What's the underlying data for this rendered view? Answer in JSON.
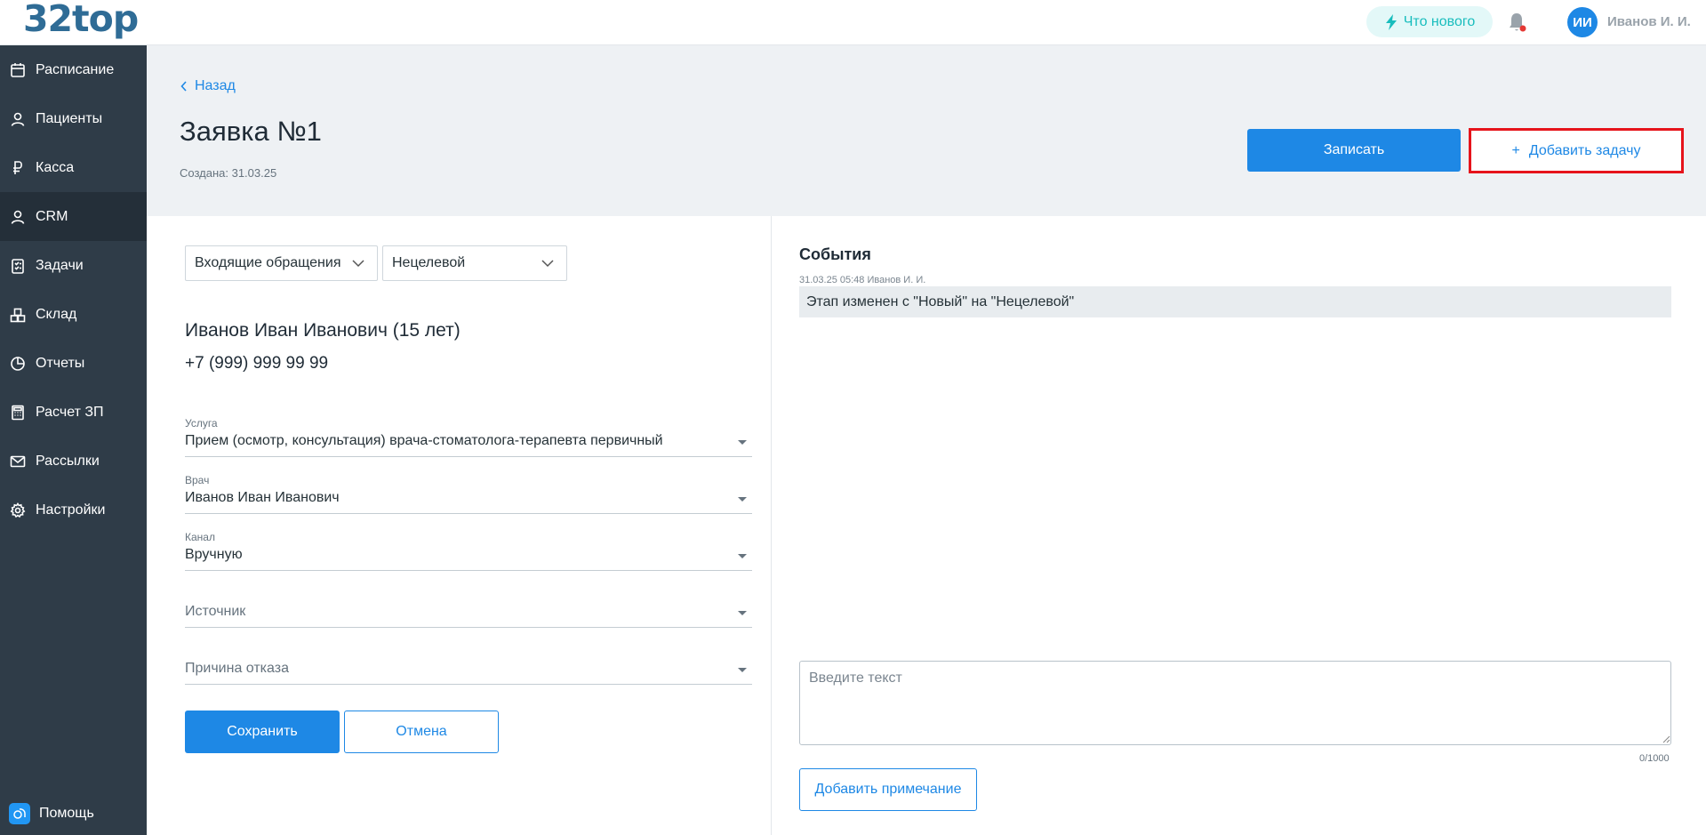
{
  "app": {
    "logo": "32top"
  },
  "topbar": {
    "whats_new": "Что нового",
    "avatar_initials": "ИИ",
    "user_name": "Иванов И. И."
  },
  "sidebar": {
    "items": [
      {
        "label": "Расписание",
        "icon": "calendar-icon"
      },
      {
        "label": "Пациенты",
        "icon": "user-icon"
      },
      {
        "label": "Касса",
        "icon": "ruble-icon"
      },
      {
        "label": "CRM",
        "icon": "user-icon",
        "active": true
      },
      {
        "label": "Задачи",
        "icon": "checklist-icon"
      },
      {
        "label": "Склад",
        "icon": "boxes-icon"
      },
      {
        "label": "Отчеты",
        "icon": "pie-chart-icon"
      },
      {
        "label": "Расчет ЗП",
        "icon": "calculator-icon"
      },
      {
        "label": "Рассылки",
        "icon": "mail-icon"
      },
      {
        "label": "Настройки",
        "icon": "gear-icon"
      }
    ],
    "help": "Помощь"
  },
  "header": {
    "back": "Назад",
    "title": "Заявка №1",
    "created": "Создана: 31.03.25",
    "book_button": "Записать",
    "add_task_button": "Добавить задачу",
    "add_task_plus": "+"
  },
  "form": {
    "pipeline_select": "Входящие обращения",
    "stage_select": "Нецелевой",
    "patient_name": "Иванов Иван Иванович (15 лет)",
    "patient_phone": "+7 (999) 999 99 99",
    "service": {
      "label": "Услуга",
      "value": "Прием (осмотр, консультация) врача-стоматолога-терапевта первичный"
    },
    "doctor": {
      "label": "Врач",
      "value": "Иванов Иван Иванович"
    },
    "channel": {
      "label": "Канал",
      "value": "Вручную"
    },
    "source": {
      "placeholder": "Источник"
    },
    "reject_reason": {
      "placeholder": "Причина отказа"
    },
    "save_button": "Сохранить",
    "cancel_button": "Отмена"
  },
  "events": {
    "title": "События",
    "items": [
      {
        "meta": "31.03.25 05:48 Иванов И. И.",
        "text": "Этап изменен с \"Новый\" на \"Нецелевой\""
      }
    ],
    "note_placeholder": "Введите текст",
    "counter": "0/1000",
    "add_note_button": "Добавить примечание"
  },
  "colors": {
    "sidebar_bg": "#2f3c48",
    "sidebar_active": "#242f39",
    "primary": "#1e88e5",
    "header_bg": "#eef1f4",
    "highlight_border": "#e6141b",
    "whats_new_bg": "#e3f8f8",
    "whats_new_text": "#18bdbd"
  }
}
